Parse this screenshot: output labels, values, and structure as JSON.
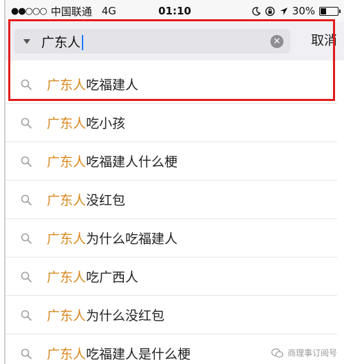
{
  "status_bar": {
    "signal": "●●○○○",
    "carrier": "中国联通",
    "network": "4G",
    "time": "01:10",
    "icons": [
      "moon-icon",
      "lock-rotation-icon",
      "location-arrow-icon"
    ],
    "battery_text": "30%",
    "battery_level": 0.3
  },
  "search": {
    "query": "广东人",
    "cancel_label": "取消"
  },
  "suggestions": [
    {
      "highlight": "广东人",
      "rest": "吃福建人"
    },
    {
      "highlight": "广东人",
      "rest": "吃小孩"
    },
    {
      "highlight": "广东人",
      "rest": "吃福建人什么梗"
    },
    {
      "highlight": "广东人",
      "rest": "没红包"
    },
    {
      "highlight": "广东人",
      "rest": "为什么吃福建人"
    },
    {
      "highlight": "广东人",
      "rest": "吃广西人"
    },
    {
      "highlight": "广东人",
      "rest": "为什么没红包"
    },
    {
      "highlight": "广东人",
      "rest": "吃福建人是什么梗"
    }
  ],
  "watermark": {
    "text": "商理事订阅号"
  },
  "colors": {
    "highlight": "#d8871c",
    "annotation_box": "#e21b1b",
    "cursor": "#1a7cff"
  }
}
